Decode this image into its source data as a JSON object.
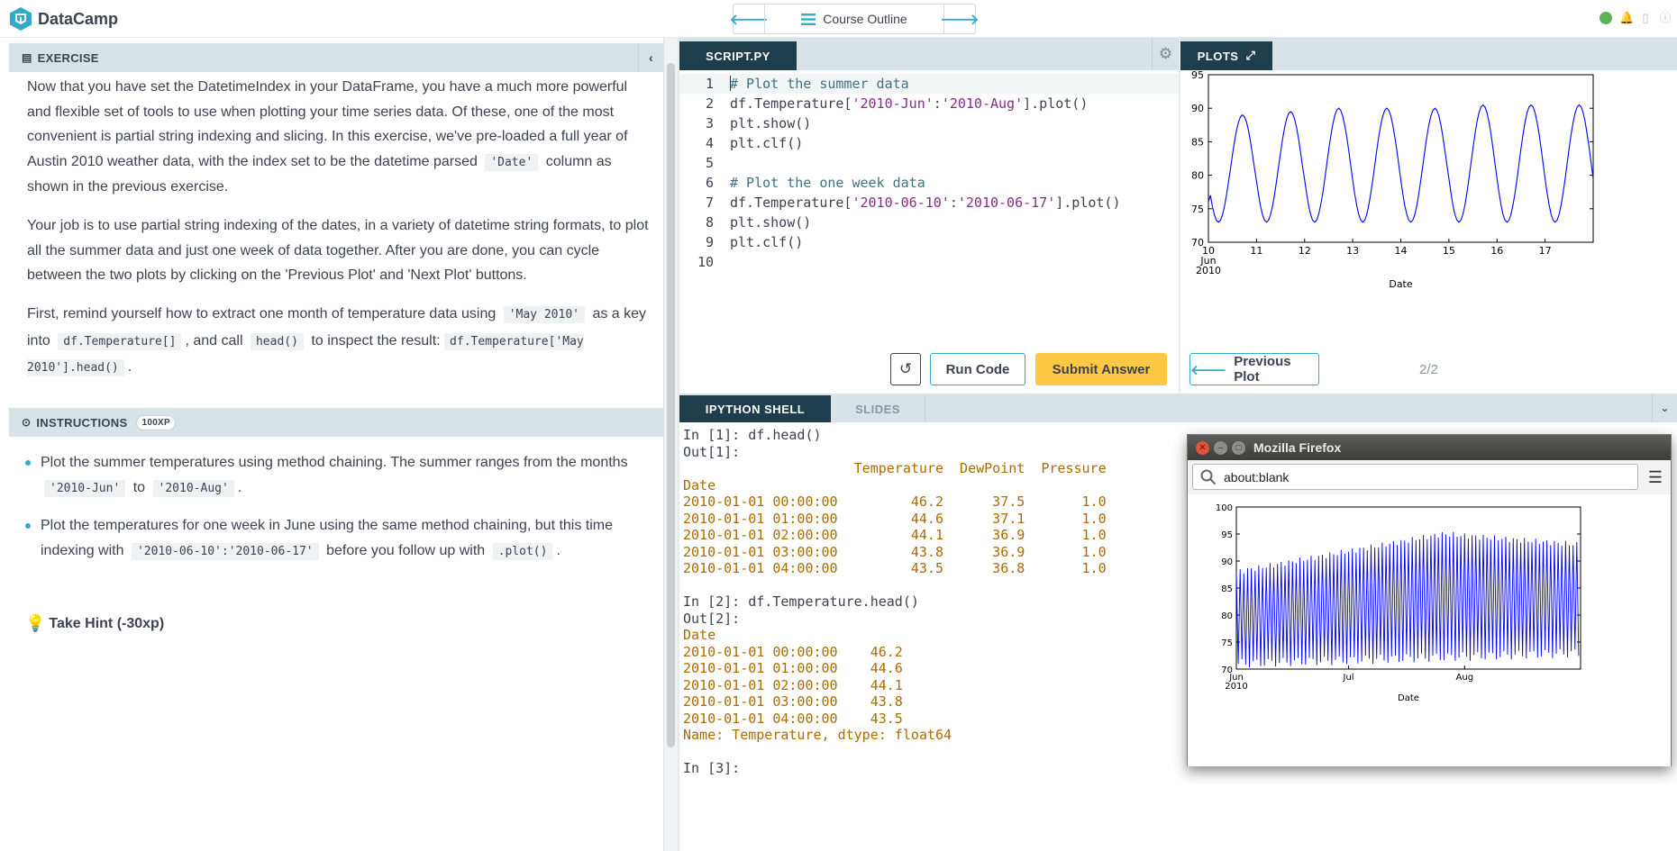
{
  "app": {
    "brand": "DataCamp"
  },
  "topbar": {
    "outline_label": "Course Outline",
    "status_color": "#5eb158"
  },
  "exercise": {
    "header": "EXERCISE",
    "p1": {
      "a": "Now that you have set the DatetimeIndex in your DataFrame, you have a much more powerful and flexible set of tools to use when plotting your time series data. Of these, one of the most convenient is partial string indexing and slicing. In this exercise, we've pre-loaded a full year of Austin 2010 weather data, with the index set to be the datetime parsed",
      "code1": "'Date'",
      "b": "column as shown in the previous exercise."
    },
    "p2": "Your job is to use partial string indexing of the dates, in a variety of datetime string formats, to plot all the summer data and just one week of data together. After you are done, you can cycle between the two plots by clicking on the 'Previous Plot' and 'Next Plot' buttons.",
    "p3": {
      "a": "First, remind yourself how to extract one month of temperature data using",
      "code1": "'May 2010'",
      "b": "as a key into",
      "code2": "df.Temperature[]",
      "c": ", and call",
      "code3": "head()",
      "d": "to inspect the result:",
      "code4": "df.Temperature['May 2010'].head()",
      "e": "."
    }
  },
  "instructions": {
    "header": "INSTRUCTIONS",
    "xp": "100XP",
    "b1": {
      "a": "Plot the summer temperatures using method chaining. The summer ranges from the months",
      "code1": "'2010-Jun'",
      "b": "to",
      "code2": "'2010-Aug'",
      "c": "."
    },
    "b2": {
      "a": "Plot the temperatures for one week in June using the same method chaining, but this time indexing with",
      "code1": "'2010-06-10':'2010-06-17'",
      "b": "before you follow up with",
      "code2": ".plot()",
      "c": "."
    },
    "hint": "Take Hint (-30xp)"
  },
  "script": {
    "tab": "SCRIPT.PY",
    "line_numbers": [
      "1",
      "2",
      "3",
      "4",
      "5",
      "6",
      "7",
      "8",
      "9",
      "10"
    ],
    "l1": "# Plot the summer data",
    "l2": {
      "a": "df.Temperature[",
      "s1": "'2010-Jun'",
      "c": ":",
      "s2": "'2010-Aug'",
      "d": "].plot()"
    },
    "l3": "plt.show()",
    "l4": "plt.clf()",
    "l6": "# Plot the one week data",
    "l7": {
      "a": "df.Temperature[",
      "s1": "'2010-06-10'",
      "c": ":",
      "s2": "'2010-06-17'",
      "d": "].plot()"
    },
    "l8": "plt.show()",
    "l9": "plt.clf()",
    "reset_icon": "reset-icon",
    "run": "Run Code",
    "submit": "Submit Answer"
  },
  "plots": {
    "tab": "PLOTS",
    "prev": "Previous Plot",
    "counter": "2/2"
  },
  "shell": {
    "tab": "IPYTHON SHELL",
    "slides": "SLIDES",
    "lines": [
      {
        "text": "In [1]: df.head()",
        "cls": ""
      },
      {
        "text": "Out[1]:",
        "cls": ""
      },
      {
        "text": "                     Temperature  DewPoint  Pressure",
        "cls": "out"
      },
      {
        "text": "Date",
        "cls": "out"
      },
      {
        "text": "2010-01-01 00:00:00         46.2      37.5       1.0",
        "cls": "out"
      },
      {
        "text": "2010-01-01 01:00:00         44.6      37.1       1.0",
        "cls": "out"
      },
      {
        "text": "2010-01-01 02:00:00         44.1      36.9       1.0",
        "cls": "out"
      },
      {
        "text": "2010-01-01 03:00:00         43.8      36.9       1.0",
        "cls": "out"
      },
      {
        "text": "2010-01-01 04:00:00         43.5      36.8       1.0",
        "cls": "out"
      },
      {
        "text": "",
        "cls": ""
      },
      {
        "text": "In [2]: df.Temperature.head()",
        "cls": ""
      },
      {
        "text": "Out[2]:",
        "cls": ""
      },
      {
        "text": "Date",
        "cls": "out"
      },
      {
        "text": "2010-01-01 00:00:00    46.2",
        "cls": "out"
      },
      {
        "text": "2010-01-01 01:00:00    44.6",
        "cls": "out"
      },
      {
        "text": "2010-01-01 02:00:00    44.1",
        "cls": "out"
      },
      {
        "text": "2010-01-01 03:00:00    43.8",
        "cls": "out"
      },
      {
        "text": "2010-01-01 04:00:00    43.5",
        "cls": "out"
      },
      {
        "text": "Name: Temperature, dtype: float64",
        "cls": "out"
      },
      {
        "text": "",
        "cls": ""
      },
      {
        "text": "In [3]:",
        "cls": ""
      }
    ]
  },
  "firefox": {
    "title": "Mozilla Firefox",
    "url": "about:blank"
  },
  "chart_data": [
    {
      "type": "line",
      "xlabel": "Date",
      "ylabel": "",
      "ylim": [
        70,
        95
      ],
      "yticks": [
        "70",
        "75",
        "80",
        "85",
        "90",
        "95"
      ],
      "xticks": [
        "10\nJun\n2010",
        "11",
        "12",
        "13",
        "14",
        "15",
        "16",
        "17"
      ],
      "x_range": [
        "2010-06-10",
        "2010-06-17 23:00"
      ],
      "series_color": "#0000ff",
      "series": [
        {
          "name": "",
          "daily_min": [
            73,
            73,
            73,
            73,
            73,
            73,
            73,
            73
          ],
          "daily_max": [
            89,
            89.5,
            90,
            90,
            90,
            90.5,
            90.5,
            90.5
          ]
        }
      ]
    },
    {
      "type": "line",
      "xlabel": "Date",
      "ylabel": "",
      "ylim": [
        70,
        100
      ],
      "yticks": [
        "70",
        "75",
        "80",
        "85",
        "90",
        "95",
        "100"
      ],
      "xticks": [
        "Jun\n2010",
        "Jul",
        "Aug"
      ],
      "x_range": [
        "2010-06-01",
        "2010-08-31"
      ],
      "series_color": "#0000ff",
      "series": [
        {
          "name": "",
          "envelope_min_start": 71,
          "envelope_min_end": 73,
          "envelope_max_start": 88,
          "envelope_max_peak": 95,
          "envelope_max_end": 93
        }
      ]
    }
  ]
}
